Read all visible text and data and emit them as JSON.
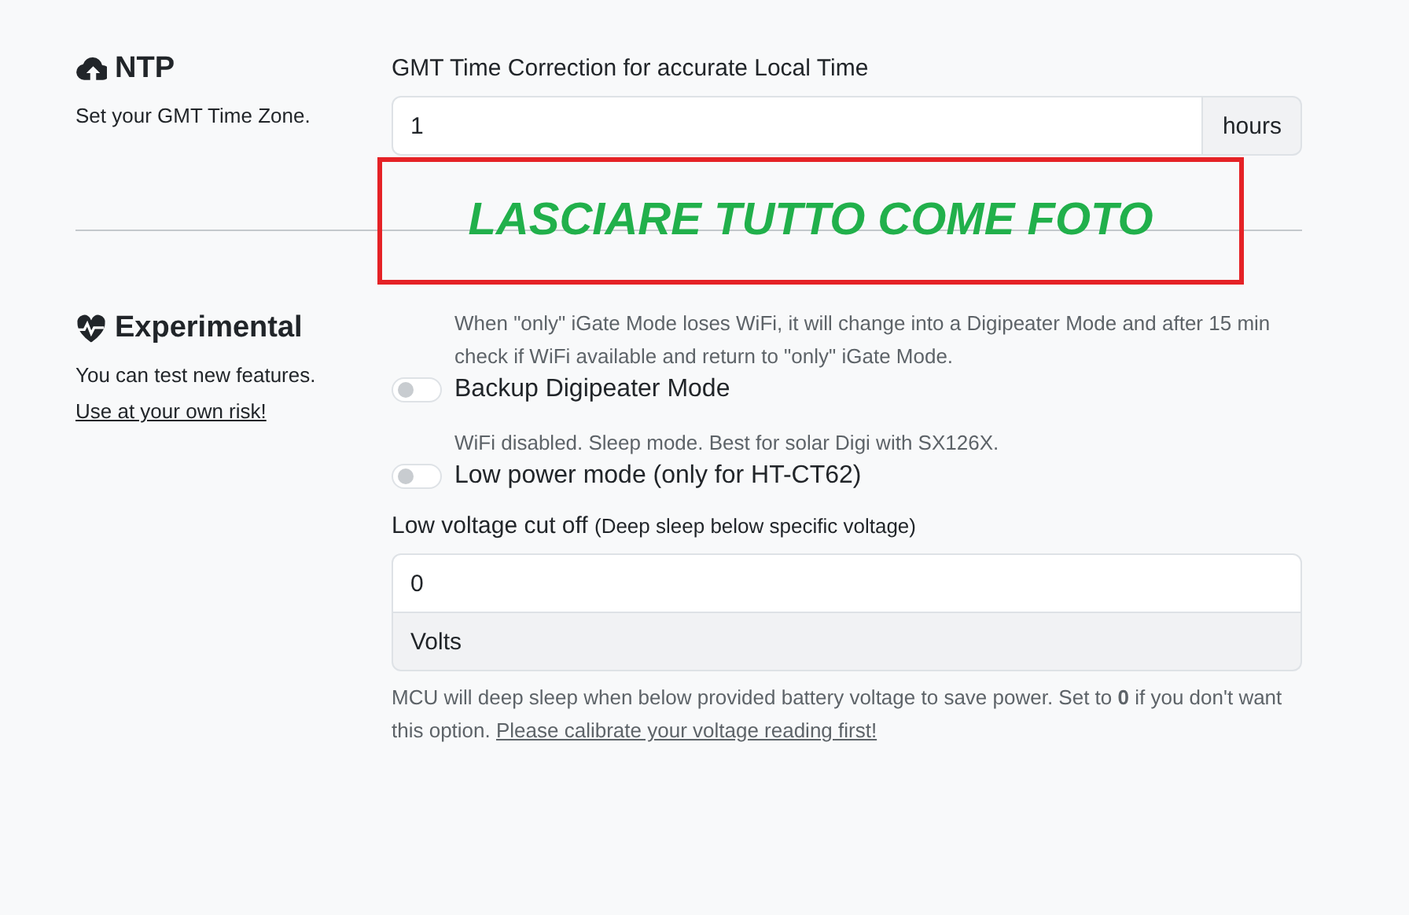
{
  "sections": [
    {
      "title": "NTP",
      "description": "Set your GMT Time Zone.",
      "fields": [
        {
          "kind": "group-input",
          "label": "GMT Time Correction for accurate Local Time",
          "value": "1",
          "addon": "hours"
        }
      ]
    },
    {
      "title": "Experimental",
      "description": "You can test new features.",
      "link": "Use at your own risk!",
      "fields": [
        {
          "kind": "switch",
          "help": "When \"only\" iGate Mode loses WiFi, it will change into a Digipeater Mode and after 15 min check if WiFi available and return to \"only\" iGate Mode.",
          "label": "Backup Digipeater Mode",
          "checked": false
        },
        {
          "kind": "switch",
          "help": "WiFi disabled. Sleep mode. Best for solar Digi with SX126X.",
          "label": "Low power mode (only for HT-CT62)",
          "checked": false
        },
        {
          "kind": "stacked-input",
          "label": "Low voltage cut off",
          "label_note": "(Deep sleep below specific voltage)",
          "value": "0",
          "addon": "Volts",
          "help": "MCU will deep sleep when below provided battery voltage to save power. Set to **0** if you don't want this option.",
          "help_link": "Please calibrate your voltage reading first!"
        }
      ]
    }
  ],
  "annotation": {
    "text": "LASCIARE TUTTO COME FOTO"
  }
}
